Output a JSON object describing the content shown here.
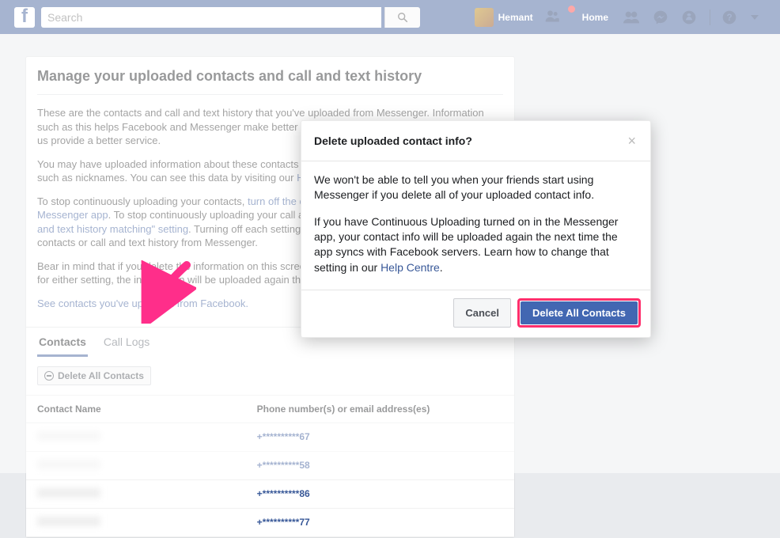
{
  "nav": {
    "search_placeholder": "Search",
    "username": "Hemant",
    "home": "Home"
  },
  "page": {
    "title": "Manage your uploaded contacts and call and text history",
    "para1": "These are the contacts and call and text history that you've uploaded from Messenger. Information such as this helps Facebook and Messenger make better suggestions for you and others, and helps us provide a better service.",
    "para2a": "You may have uploaded information about these contacts before you imported their phone numbers, such as nicknames. You can see this data by visiting our ",
    "para2_link": "Help Centre",
    "para2b": ".",
    "para3a": "To stop continuously uploading your contacts, ",
    "para3_link1": "turn off the continuous contact uploading setting in the Messenger app",
    "para3b": ". To stop continuously uploading your call and text history, turn off ",
    "para3_link2": "the \"continuous call and text history matching\" setting",
    "para3c": ". Turning off each setting will delete all of your previously uploaded contacts or call and text history from Messenger.",
    "para4": "Bear in mind that if you delete the information on this screen without turning continuous uploading on for either setting, the information will be uploaded again the next time Messenger syncs.",
    "see_link": "See contacts you've uploaded from Facebook."
  },
  "tabs": {
    "contacts": "Contacts",
    "call_logs": "Call Logs"
  },
  "delete_all_btn": "Delete All Contacts",
  "table": {
    "col_name": "Contact Name",
    "col_phone": "Phone number(s) or email address(es)",
    "rows": [
      {
        "name": "",
        "phone": "+**********67"
      },
      {
        "name": "",
        "phone": "+**********58"
      },
      {
        "name": "",
        "phone": "+**********86"
      },
      {
        "name": "",
        "phone": "+**********77"
      }
    ]
  },
  "modal": {
    "title": "Delete uploaded contact info?",
    "p1": "We won't be able to tell you when your friends start using Messenger if you delete all of your uploaded contact info.",
    "p2a": "If you have Continuous Uploading turned on in the Messenger app, your contact info will be uploaded again the next time the app syncs with Facebook servers. Learn how to change that setting in our ",
    "p2_link": "Help Centre",
    "p2b": ".",
    "cancel": "Cancel",
    "confirm": "Delete All Contacts"
  }
}
